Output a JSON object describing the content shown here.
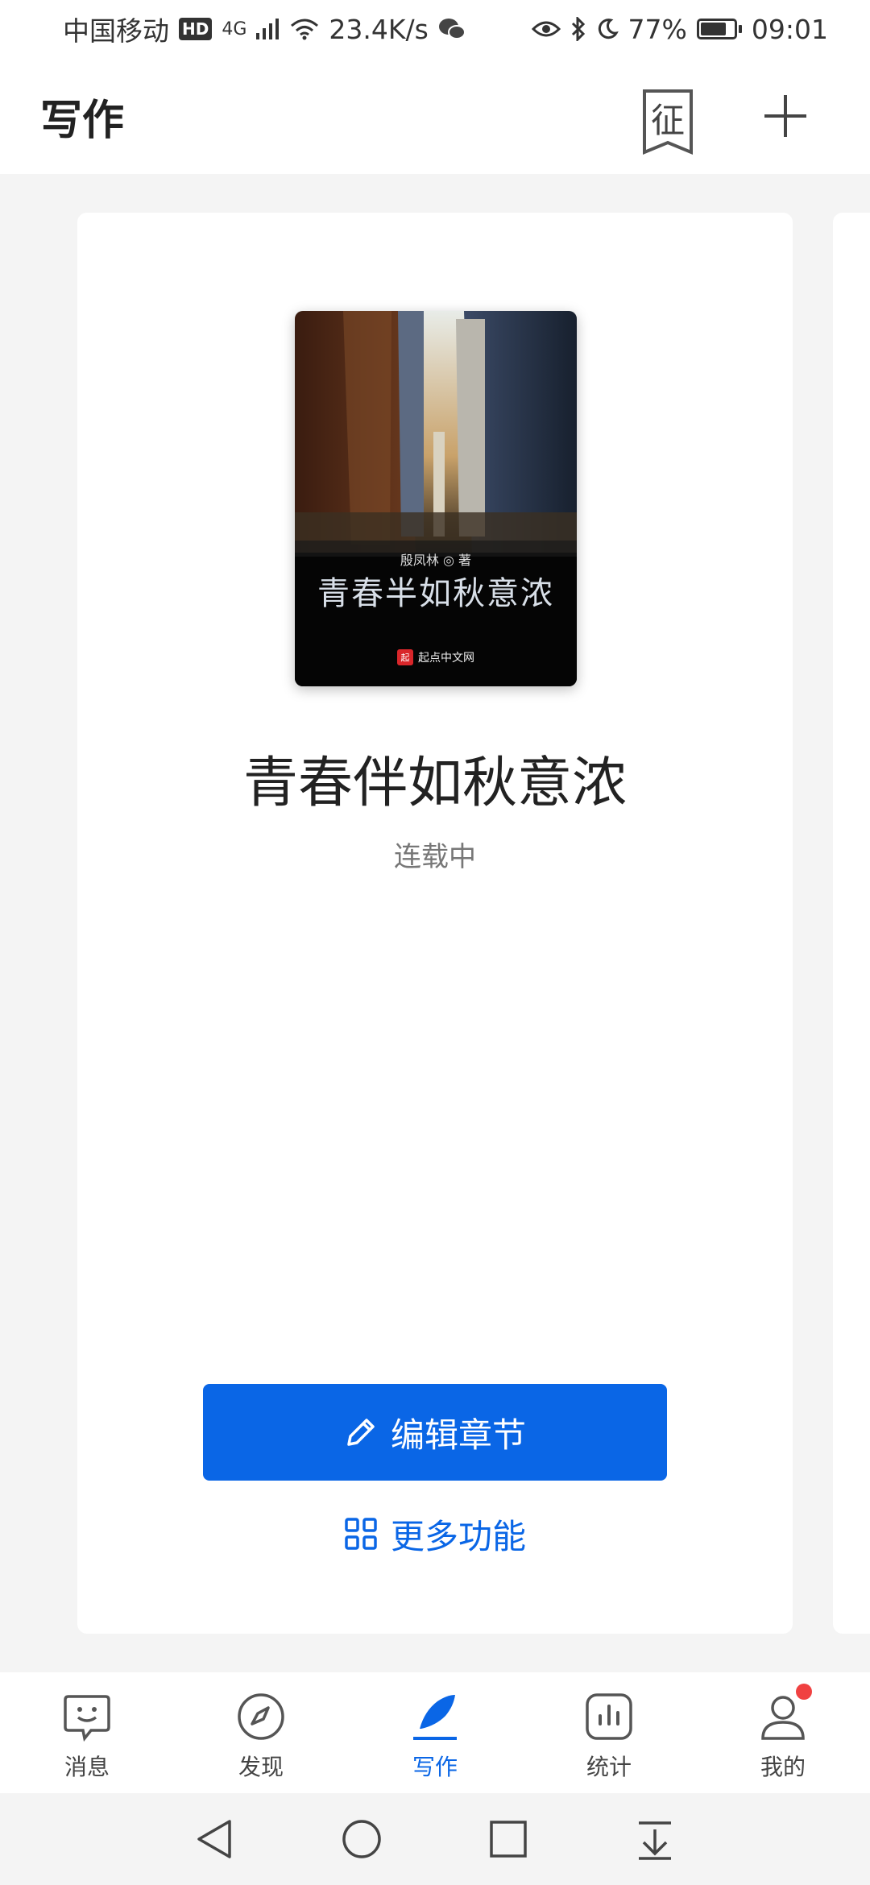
{
  "status_bar": {
    "carrier": "中国移动",
    "hd_badge": "HD",
    "network": "4G",
    "speed": "23.4K/s",
    "battery": "77%",
    "battery_level": 0.77,
    "time": "09:01"
  },
  "header": {
    "title": "写作",
    "contest_icon_text": "征"
  },
  "book": {
    "cover_author": "殷凤林 ◎ 著",
    "cover_title": "青春半如秋意浓",
    "cover_publisher": "起点中文网",
    "cover_publisher_logo": "起",
    "title": "青春伴如秋意浓",
    "status": "连载中"
  },
  "actions": {
    "edit_label": "编辑章节",
    "more_label": "更多功能"
  },
  "tabs": [
    {
      "label": "消息",
      "icon": "message-icon",
      "active": false
    },
    {
      "label": "发现",
      "icon": "compass-icon",
      "active": false
    },
    {
      "label": "写作",
      "icon": "write-icon",
      "active": true
    },
    {
      "label": "统计",
      "icon": "stats-icon",
      "active": false
    },
    {
      "label": "我的",
      "icon": "profile-icon",
      "active": false,
      "badge": true
    }
  ],
  "colors": {
    "accent": "#0a66e6",
    "badge": "#f04141"
  }
}
